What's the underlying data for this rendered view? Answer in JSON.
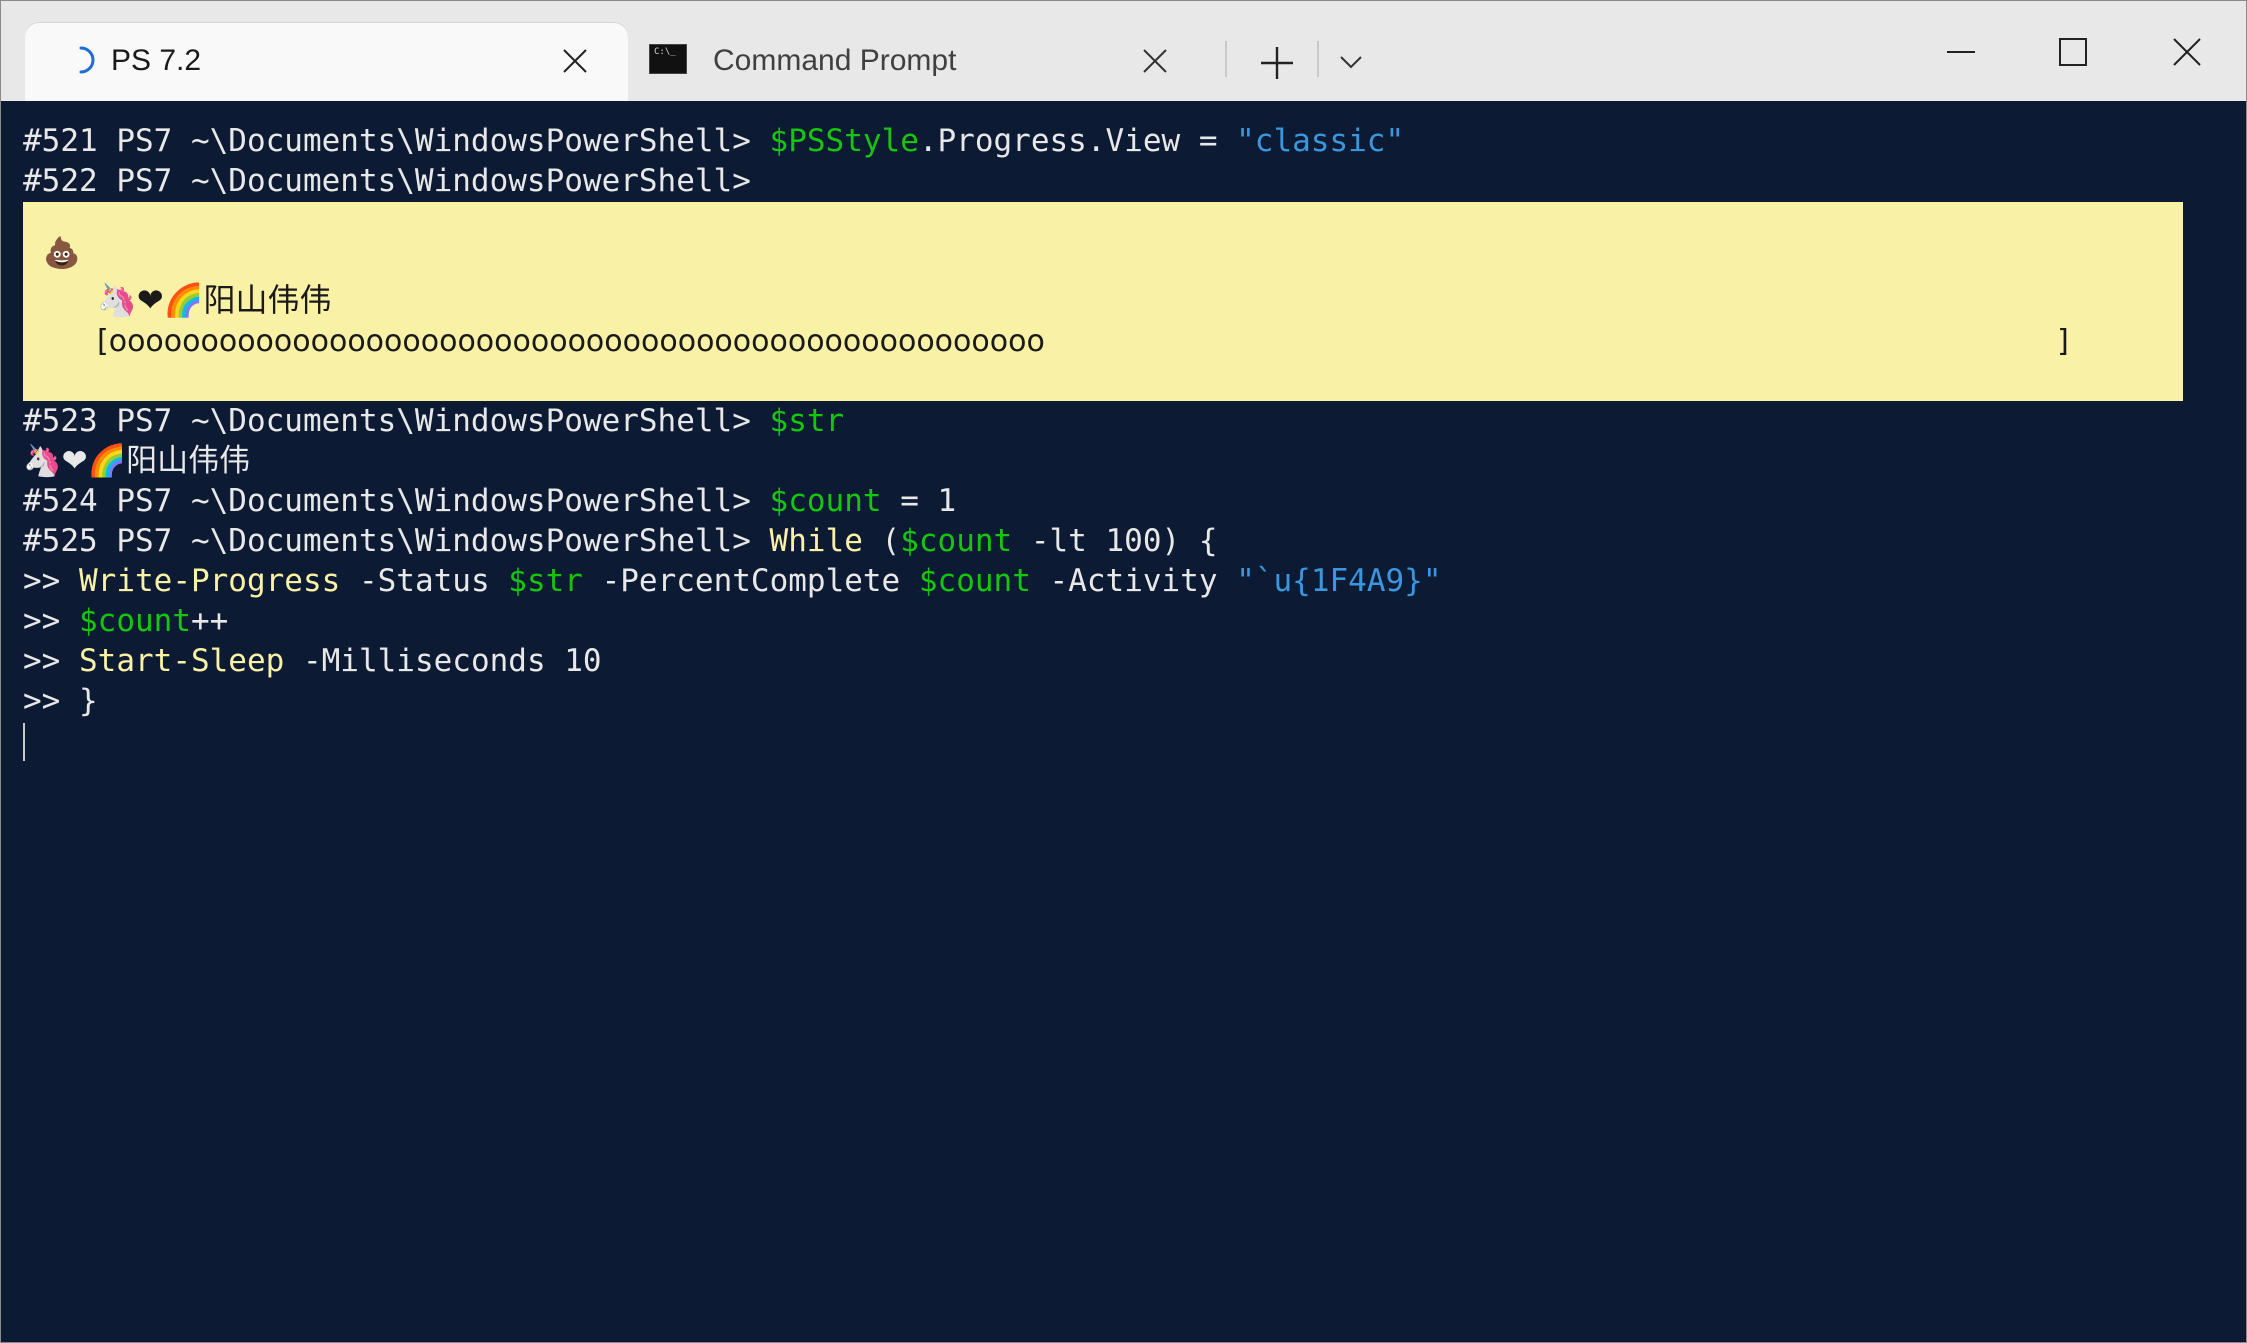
{
  "tabs": [
    {
      "title": "PS 7.2",
      "icon": "loading-spinner-icon"
    },
    {
      "title": "Command Prompt",
      "icon": "cmd-icon",
      "icon_text": "C:\\_"
    }
  ],
  "colors": {
    "terminal_bg": "#0c1a33",
    "prompt": "#e8e8e8",
    "variable": "#16c60c",
    "string": "#3a96dd",
    "command": "#f9f1a5",
    "progress_bg": "#f9f1a5"
  },
  "lines": {
    "l521": {
      "prompt": "#521 PS7 ~\\Documents\\WindowsPowerShell> ",
      "var": "$PSStyle",
      "rest": ".Progress.View = ",
      "str": "\"classic\""
    },
    "l522": {
      "prompt": "#522 PS7 ~\\Documents\\WindowsPowerShell>"
    },
    "l523": {
      "prompt": "#523 PS7 ~\\Documents\\WindowsPowerShell> ",
      "var": "$str"
    },
    "output523": {
      "emoji": "🦄❤🌈",
      "text": "阳山伟伟"
    },
    "l524": {
      "prompt": "#524 PS7 ~\\Documents\\WindowsPowerShell> ",
      "var": "$count",
      "rest": " = 1"
    },
    "l525": {
      "prompt": "#525 PS7 ~\\Documents\\WindowsPowerShell> ",
      "kw": "While",
      "p1": " (",
      "var": "$count",
      "rest": " -lt 100) {"
    },
    "c1": {
      "prefix": ">> ",
      "cmd": "Write-Progress",
      "a1": " -Status ",
      "v1": "$str",
      "a2": " -PercentComplete ",
      "v2": "$count",
      "a3": " -Activity ",
      "str": "\"`u{1F4A9}\""
    },
    "c2": {
      "prefix": ">> ",
      "var": "$count",
      "rest": "++"
    },
    "c3": {
      "prefix": ">> ",
      "cmd": "Start-Sleep",
      "rest": " -Milliseconds 10"
    },
    "c4": {
      "prefix": ">> ",
      "rest": "}"
    }
  },
  "progress": {
    "activity_emoji": "💩",
    "status_emoji": "🦄❤🌈",
    "status_text": "阳山伟伟",
    "bar_open": "[",
    "bar_fill": "ooooooooooooooooooooooooooooooooooooooooooooooooooo",
    "bar_close": "]"
  }
}
